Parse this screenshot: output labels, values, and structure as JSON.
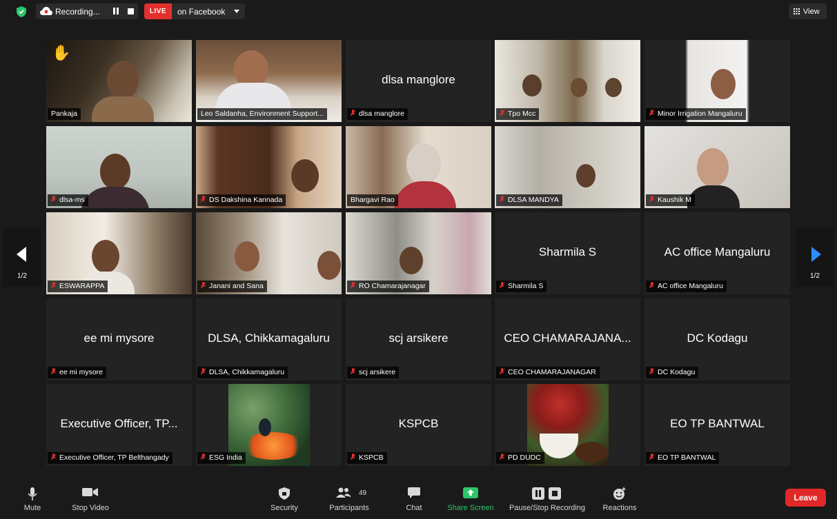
{
  "topbar": {
    "recording_label": "Recording...",
    "live_label": "LIVE",
    "live_target": "on Facebook",
    "view_label": "View"
  },
  "pager": {
    "left": "1/2",
    "right": "1/2"
  },
  "tiles": [
    {
      "name": "Pankaja",
      "center": "",
      "raised_hand": true
    },
    {
      "name": "Leo Saldanha, Environment Support...",
      "center": ""
    },
    {
      "name": "dlsa manglore",
      "center": "dlsa manglore"
    },
    {
      "name": "Tpo Mcc",
      "center": ""
    },
    {
      "name": "Minor Irrigation Mangaluru",
      "center": ""
    },
    {
      "name": "dlsa-ms",
      "center": ""
    },
    {
      "name": "DS Dakshina Kannada",
      "center": ""
    },
    {
      "name": "Bhargavi Rao",
      "center": ""
    },
    {
      "name": "DLSA MANDYA",
      "center": ""
    },
    {
      "name": "Kaushik M",
      "center": ""
    },
    {
      "name": "ESWARAPPA",
      "center": ""
    },
    {
      "name": "Janani and Sana",
      "center": ""
    },
    {
      "name": "RO Chamarajanagar",
      "center": ""
    },
    {
      "name": "Sharmila S",
      "center": "Sharmila S"
    },
    {
      "name": "AC office Mangaluru",
      "center": "AC office Mangaluru"
    },
    {
      "name": "ee mi mysore",
      "center": "ee mi mysore"
    },
    {
      "name": "DLSA, Chikkamagaluru",
      "center": "DLSA, Chikkamagaluru"
    },
    {
      "name": "scj arsikere",
      "center": "scj arsikere"
    },
    {
      "name": "CEO CHAMARAJANAGAR",
      "center": "CEO CHAMARAJANA..."
    },
    {
      "name": "DC Kodagu",
      "center": "DC Kodagu"
    },
    {
      "name": "Executive Officer, TP Belthangady",
      "center": "Executive Officer, TP..."
    },
    {
      "name": "ESG India",
      "center": ""
    },
    {
      "name": "KSPCB",
      "center": "KSPCB"
    },
    {
      "name": "PD DUDC",
      "center": ""
    },
    {
      "name": "EO TP BANTWAL",
      "center": "EO TP BANTWAL"
    }
  ],
  "toolbar": {
    "mute": "Mute",
    "stop_video": "Stop Video",
    "security": "Security",
    "participants": "Participants",
    "participants_count": "49",
    "chat": "Chat",
    "share_screen": "Share Screen",
    "pause_recording": "Pause/Stop Recording",
    "reactions": "Reactions",
    "leave": "Leave"
  },
  "colors": {
    "share_green": "#2ec56b",
    "leave_red": "#e02828",
    "active_speaker": "#cde36a",
    "mic_muted": "#e0312f"
  }
}
